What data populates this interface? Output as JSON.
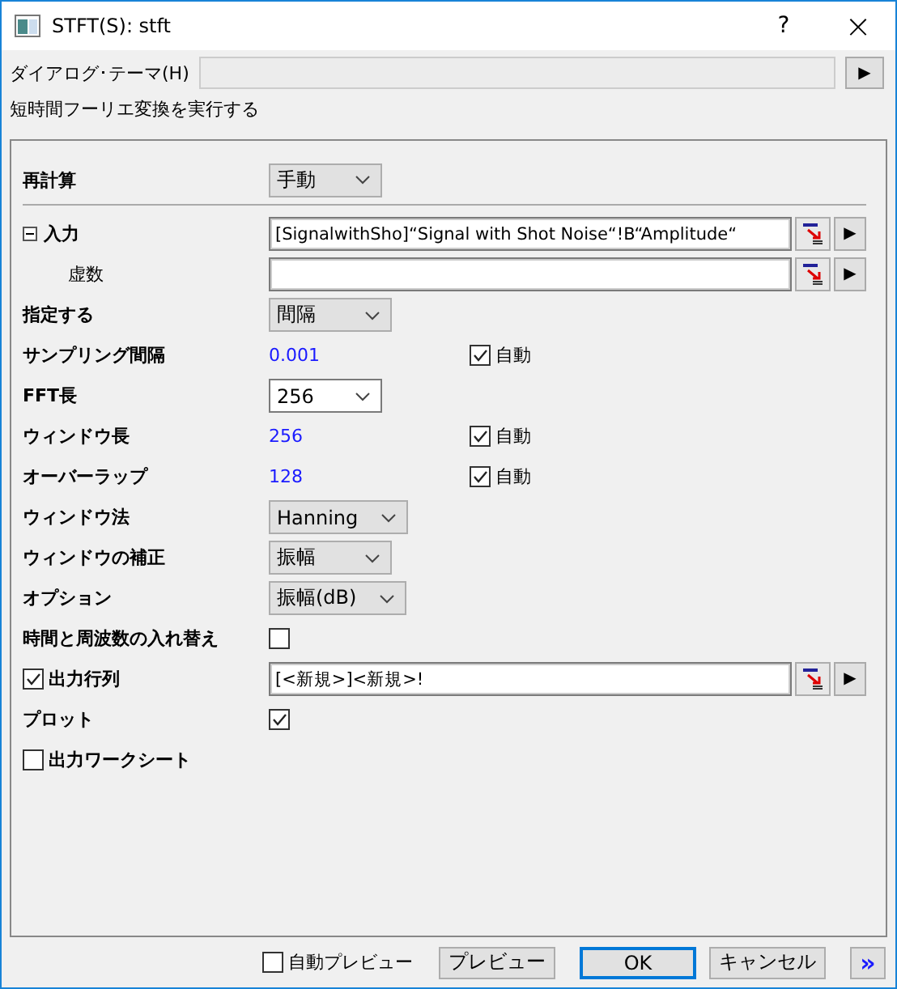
{
  "window": {
    "title": "STFT(S): stft",
    "help": "?",
    "close": "×"
  },
  "theme": {
    "label": "ダイアログ･テーマ(H)",
    "button": "▶"
  },
  "description": "短時間フーリエ変換を実行する",
  "recalc": {
    "label": "再計算",
    "value": "手動"
  },
  "rows": [
    {
      "kind": "field",
      "label": "入力",
      "expanded": true,
      "value": "[SignalwithSho]“Signal with Shot Noise“!B“Amplitude“",
      "button": "▶",
      "children": [
        {
          "kind": "field",
          "label": "虚数",
          "button": "▶"
        }
      ]
    },
    {
      "kind": "dropdown",
      "label": "指定する",
      "value": "間隔"
    },
    {
      "kind": "value_auto",
      "label": "サンプリング間隔",
      "value": "0.001",
      "auto_label": "自動",
      "checked": true
    },
    {
      "kind": "dropdown",
      "label": "FFT長",
      "value": "256",
      "editable": true
    },
    {
      "kind": "value_auto",
      "label": "ウィンドウ長",
      "value": "256",
      "auto_label": "自動",
      "checked": true
    },
    {
      "kind": "value_auto",
      "label": "オーバーラップ",
      "value": "128",
      "auto_label": "自動",
      "checked": true
    },
    {
      "kind": "dropdown",
      "label": "ウィンドウ法",
      "value": "Hanning"
    },
    {
      "kind": "dropdown",
      "label": "ウィンドウの補正",
      "value": "振幅"
    },
    {
      "kind": "dropdown",
      "label": "オプション",
      "value": "振幅(dB)"
    },
    {
      "kind": "checkbox",
      "label": "時間と周波数の入れ替え",
      "checked": false
    },
    {
      "kind": "field",
      "label": "出力行列",
      "label_checked": true,
      "value": "[<新規>]<新規>!",
      "button": "▶"
    },
    {
      "kind": "checkbox",
      "label": "プロット",
      "checked": true
    },
    {
      "kind": "label_check",
      "label": "出力ワークシート",
      "label_checked": false
    }
  ],
  "footer": {
    "auto_preview": {
      "label": "自動プレビュー",
      "checked": false
    },
    "buttons": [
      "プレビュー",
      "OK",
      "キャンセル"
    ],
    "more": "»"
  }
}
